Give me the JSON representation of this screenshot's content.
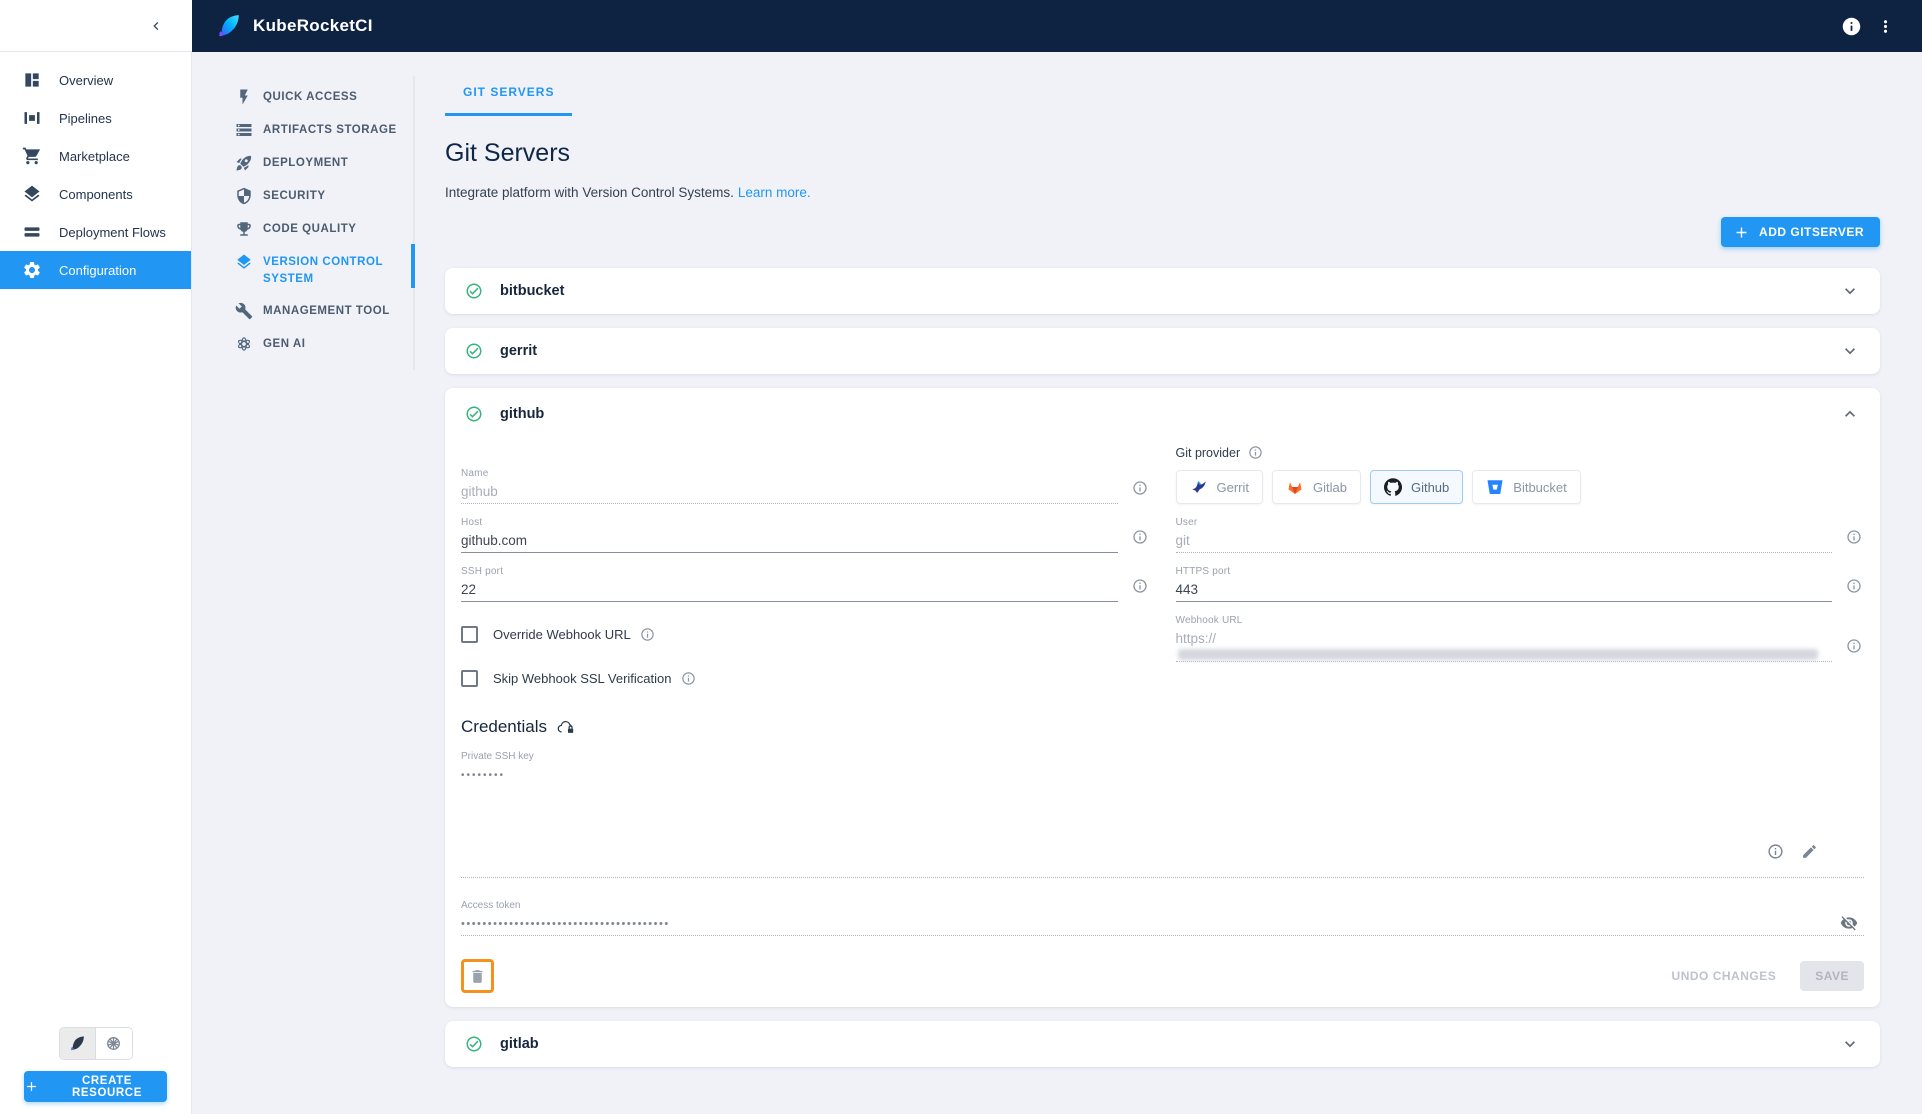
{
  "topbar": {
    "app_name": "KubeRocketCI"
  },
  "sidebar": {
    "items": [
      {
        "label": "Overview"
      },
      {
        "label": "Pipelines"
      },
      {
        "label": "Marketplace"
      },
      {
        "label": "Components"
      },
      {
        "label": "Deployment Flows"
      },
      {
        "label": "Configuration"
      }
    ],
    "active_item": "Configuration",
    "create_button": "CREATE RESOURCE"
  },
  "confignav": {
    "items": [
      {
        "label": "QUICK ACCESS"
      },
      {
        "label": "ARTIFACTS STORAGE"
      },
      {
        "label": "DEPLOYMENT"
      },
      {
        "label": "SECURITY"
      },
      {
        "label": "CODE QUALITY"
      },
      {
        "label": "VERSION CONTROL SYSTEM"
      },
      {
        "label": "MANAGEMENT TOOL"
      },
      {
        "label": "GEN AI"
      }
    ],
    "active_item": "VERSION CONTROL SYSTEM"
  },
  "page": {
    "tab": "GIT SERVERS",
    "title": "Git Servers",
    "subtitle": "Integrate platform with Version Control Systems.",
    "learn_more": "Learn more.",
    "add_button": "ADD GITSERVER"
  },
  "servers": [
    {
      "name": "bitbucket",
      "expanded": false
    },
    {
      "name": "gerrit",
      "expanded": false
    },
    {
      "name": "github",
      "expanded": true
    },
    {
      "name": "gitlab",
      "expanded": false
    }
  ],
  "form": {
    "name": {
      "label": "Name",
      "value": "github"
    },
    "provider": {
      "label": "Git provider",
      "options": [
        {
          "label": "Gerrit"
        },
        {
          "label": "Gitlab"
        },
        {
          "label": "Github"
        },
        {
          "label": "Bitbucket"
        }
      ],
      "selected": "Github"
    },
    "host": {
      "label": "Host",
      "value": "github.com"
    },
    "user": {
      "label": "User",
      "value": "git"
    },
    "ssh_port": {
      "label": "SSH port",
      "value": "22"
    },
    "https_port": {
      "label": "HTTPS port",
      "value": "443"
    },
    "override_webhook": {
      "label": "Override Webhook URL",
      "checked": false
    },
    "webhook_url": {
      "label": "Webhook URL",
      "value_prefix": "https://"
    },
    "skip_ssl": {
      "label": "Skip Webhook SSL Verification",
      "checked": false
    },
    "credentials_title": "Credentials",
    "private_ssh_key": {
      "label": "Private SSH key",
      "masked_value": "••••••••"
    },
    "access_token": {
      "label": "Access token",
      "masked_value": "•••••••••••••••••••••••••••••••••••••••"
    },
    "actions": {
      "undo": "UNDO CHANGES",
      "save": "SAVE"
    }
  },
  "icons": [
    "collapse-left-icon",
    "quill-logo-icon",
    "info-icon",
    "kebab-menu-icon",
    "overview-icon",
    "pipelines-icon",
    "marketplace-cart-icon",
    "components-layers-icon",
    "deployment-flows-icon",
    "configuration-gear-icon",
    "quick-access-bolt-icon",
    "artifacts-storage-icon",
    "deployment-rocket-icon",
    "security-shield-icon",
    "code-quality-trophy-icon",
    "vcs-layers-icon",
    "management-tool-wrench-icon",
    "gen-ai-icon",
    "kubernetes-wheel-icon",
    "plus-icon",
    "check-circle-icon",
    "chevron-down-icon",
    "chevron-up-icon",
    "gerrit-icon",
    "gitlab-icon",
    "github-icon",
    "bitbucket-icon",
    "cloud-lock-icon",
    "pencil-icon",
    "eye-off-icon",
    "trash-icon"
  ],
  "colors": {
    "accent": "#2196F3",
    "topbar_bg": "#0E2342",
    "success": "#36B37E",
    "highlight_orange": "#F5921E",
    "page_bg": "#F0F2F8"
  }
}
